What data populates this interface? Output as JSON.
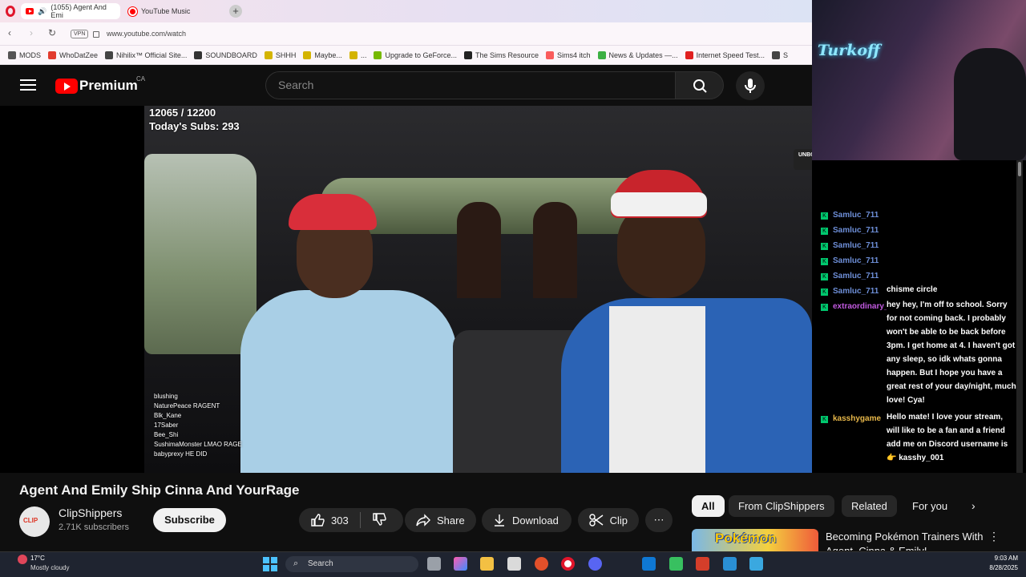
{
  "browser": {
    "tabs": [
      {
        "label": "(1055) Agent And Emi",
        "icon": "youtube-icon"
      },
      {
        "label": "YouTube Music",
        "icon": "youtube-music-icon"
      }
    ],
    "new_tab": "+",
    "vpn_label": "VPN",
    "url": "www.youtube.com/watch",
    "bookmarks": [
      {
        "label": "MODS",
        "color": "#555555"
      },
      {
        "label": "WhoDatZee",
        "color": "#e23b2e"
      },
      {
        "label": "Nihilix™ Official Site...",
        "color": "#444444"
      },
      {
        "label": "SOUNDBOARD",
        "color": "#333333"
      },
      {
        "label": "SHHH",
        "color": "#d4b400"
      },
      {
        "label": "Maybe...",
        "color": "#d4b400"
      },
      {
        "label": "...",
        "color": "#d4b400"
      },
      {
        "label": "Upgrade to GeForce...",
        "color": "#76b900"
      },
      {
        "label": "The Sims Resource",
        "color": "#222222"
      },
      {
        "label": "Sims4 itch",
        "color": "#fa5c5c"
      },
      {
        "label": "News & Updates —...",
        "color": "#3cb043"
      },
      {
        "label": "Internet Speed Test...",
        "color": "#e02020"
      },
      {
        "label": "S",
        "color": "#444444"
      }
    ]
  },
  "youtube": {
    "brand": "Premium",
    "country": "CA",
    "search_placeholder": "Search"
  },
  "video_overlay": {
    "subs_count": "12065 / 12200",
    "today_subs": "Today's Subs: 293",
    "brand_logo": "UNBOXED",
    "mini_chat": [
      "blushing",
      "NaturePeace  RAGENT",
      "Blk_Kane",
      "17Saber",
      "Bee_Shi",
      "SushimaMonster  LMAO RAGE",
      "babyprexy  HE DID"
    ]
  },
  "webcam": {
    "sign_text": "Turkoff"
  },
  "stream_chat": {
    "messages": [
      {
        "user": "Samluc_711",
        "text": ""
      },
      {
        "user": "Samluc_711",
        "text": ""
      },
      {
        "user": "Samluc_711",
        "text": ""
      },
      {
        "user": "Samluc_711",
        "text": ""
      },
      {
        "user": "Samluc_711",
        "text": ""
      },
      {
        "user": "Samluc_711",
        "text": "chisme circle"
      },
      {
        "user": "extraordinary_...",
        "text": "hey hey, I'm off to school. Sorry for not coming back. I probably won't be able to be back before 3pm. I get home at 4. I haven't got any sleep, so idk whats gonna happen. But I hope you have a great rest of your day/night, much love! Cya!"
      },
      {
        "user": "kasshygame",
        "text": "Hello mate! I love your stream, will like to be a fan and a friend add me on Discord username is 👉 kasshy_001"
      }
    ]
  },
  "video_info": {
    "title": "Agent And Emily Ship Cinna And YourRage",
    "channel": "ClipShippers",
    "subscribers": "2.71K subscribers",
    "subscribe_label": "Subscribe",
    "likes": "303",
    "share_label": "Share",
    "download_label": "Download",
    "clip_label": "Clip",
    "more_label": "⋯"
  },
  "recommendations": {
    "chips": [
      "All",
      "From ClipShippers",
      "Related",
      "For you"
    ],
    "next_icon": "›",
    "first_title": "Becoming Pokémon Trainers With Agent, Cinna & Emily!",
    "thumb_text": "Pokémon"
  },
  "taskbar": {
    "temperature": "17°C",
    "condition": "Mostly cloudy",
    "search_label": "Search",
    "time": "9:03 AM",
    "date": "8/28/2025"
  }
}
